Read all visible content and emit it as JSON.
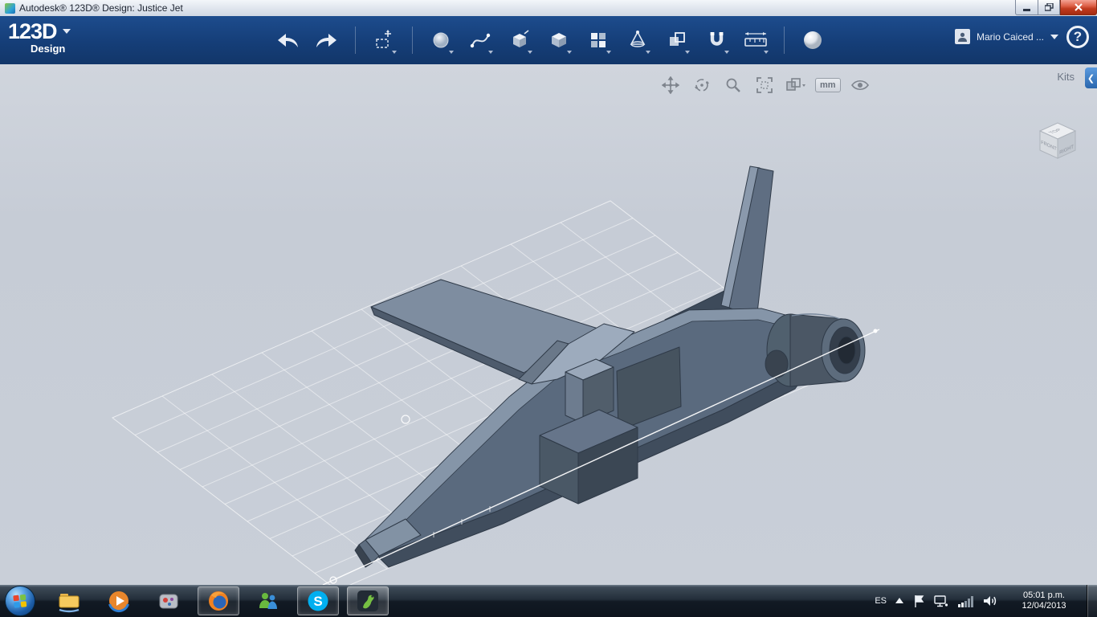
{
  "window": {
    "title": "Autodesk® 123D® Design: Justice Jet"
  },
  "app_bar": {
    "logo_text": "123D",
    "logo_sub": "Design",
    "user_name": "Mario Caiced ...",
    "help_label": "?",
    "toolbar_icons": [
      "undo-icon",
      "redo-icon",
      "transform-move-icon",
      "primitives-sphere-icon",
      "sketch-spline-icon",
      "tweak-cube-icon",
      "solid-box-icon",
      "pattern-grid-icon",
      "construct-cone-icon",
      "combine-cubes-icon",
      "snap-magnet-icon",
      "measure-ruler-icon",
      "material-sphere-icon"
    ]
  },
  "viewport": {
    "kits_panel_label": "Kits",
    "collapse_chevron": "❮",
    "nav_units_label": "mm",
    "nav_icons": [
      "pan-icon",
      "orbit-icon",
      "zoom-icon",
      "fit-view-icon",
      "display-settings-icon",
      "units-button",
      "visibility-eye-icon"
    ],
    "view_cube": {
      "top": "TOP",
      "front": "FRONT",
      "right": "RIGHT"
    }
  },
  "taskbar": {
    "language_indicator": "ES",
    "skype_letter": "S",
    "clock_time": "05:01 p.m.",
    "clock_date": "12/04/2013",
    "pinned_apps": [
      "windows-explorer",
      "windows-media-player",
      "palette-app",
      "firefox",
      "windows-live-messenger",
      "skype",
      "123d-design"
    ]
  },
  "colors": {
    "appbar_blue": "#153e78",
    "viewport_gray": "#c9cfd8",
    "close_button_red": "#c03a1e",
    "kits_tab_blue": "#2a66ad",
    "skype_blue": "#00aff0",
    "firefox_orange": "#f08222",
    "messenger_green": "#69b93e",
    "model_gray_blue": "#5a6a7e"
  }
}
